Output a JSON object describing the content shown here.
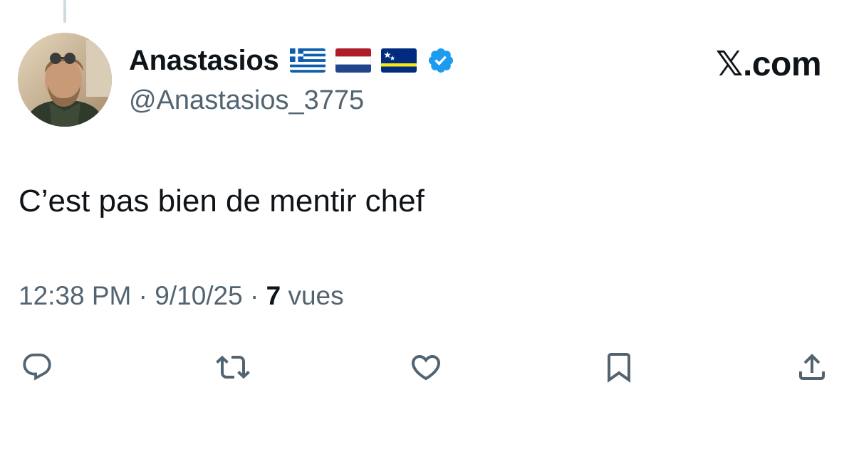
{
  "tweet": {
    "author": {
      "display_name": "Anastasios",
      "handle": "@Anastasios_3775",
      "flags": [
        "flag-greece-icon",
        "flag-netherlands-icon",
        "flag-curacao-icon"
      ],
      "verified_icon": "verified-badge-icon"
    },
    "brand": "𝕏.com",
    "text": "C’est pas bien de mentir chef",
    "meta": {
      "time": "12:38 PM",
      "separator": " · ",
      "date": "9/10/25",
      "views_count": "7",
      "views_label": " vues"
    },
    "actions": [
      "reply-icon",
      "repost-icon",
      "like-icon",
      "bookmark-icon",
      "share-icon"
    ]
  },
  "colors": {
    "text_primary": "#0f1419",
    "text_secondary": "#536471",
    "verified_blue": "#1d9bf0",
    "icon_gray": "#536471",
    "thread_line": "#cfd9de"
  }
}
